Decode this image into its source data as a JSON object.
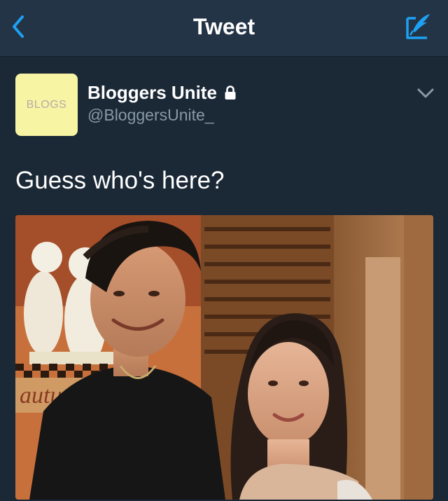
{
  "nav": {
    "title": "Tweet",
    "back_icon": "chevron-left-icon",
    "compose_icon": "compose-feather-icon",
    "accent_color": "#1da1f2"
  },
  "tweet": {
    "author": {
      "display_name": "Bloggers Unite",
      "handle": "@BloggersUnite_",
      "avatar_text": "BLOGS",
      "avatar_color": "#f7f4a4",
      "protected_icon": "lock-icon"
    },
    "menu_icon": "chevron-down-icon",
    "text": "Guess who's here?",
    "media": {
      "type": "photo",
      "visible_text": "autu"
    }
  },
  "colors": {
    "background": "#1b2836",
    "nav_background": "#243447",
    "secondary_text": "#8899a6",
    "primary_text": "#ffffff"
  }
}
